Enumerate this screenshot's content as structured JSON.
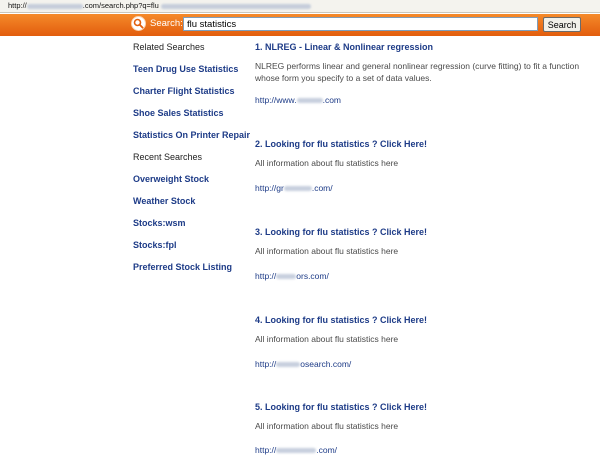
{
  "address_bar": {
    "prefix": "http://",
    "mid": ".com/search.php?q=flu"
  },
  "search": {
    "label": "Search:",
    "value": "flu statistics",
    "button": "Search"
  },
  "sidebar": {
    "related_heading": "Related Searches",
    "related": [
      "Teen Drug Use Statistics",
      "Charter Flight Statistics",
      "Shoe Sales Statistics",
      "Statistics On Printer Repair"
    ],
    "recent_heading": "Recent Searches",
    "recent": [
      "Overweight Stock",
      "Weather Stock",
      "Stocks:wsm",
      "Stocks:fpl",
      "Preferred Stock Listing"
    ]
  },
  "results": [
    {
      "title": "1. NLREG - Linear & Nonlinear regression",
      "desc": "NLREG performs linear and general nonlinear regression (curve fitting) to fit a function whose form you specify to a set of data values.",
      "url_pre": "http://www.",
      "url_post": ".com"
    },
    {
      "title": "2. Looking for flu statistics ? Click Here!",
      "desc": "All information about flu statistics here",
      "url_pre": "http://gr",
      "url_post": ".com/"
    },
    {
      "title": "3. Looking for flu statistics ? Click Here!",
      "desc": "All information about flu statistics here",
      "url_pre": "http://",
      "url_post": "ors.com/"
    },
    {
      "title": "4. Looking for flu statistics ? Click Here!",
      "desc": "All information about flu statistics here",
      "url_pre": "http://",
      "url_post": "osearch.com/"
    },
    {
      "title": "5. Looking for flu statistics ? Click Here!",
      "desc": "All information about flu statistics here",
      "url_pre": "http://",
      "url_post": ".com/"
    }
  ]
}
